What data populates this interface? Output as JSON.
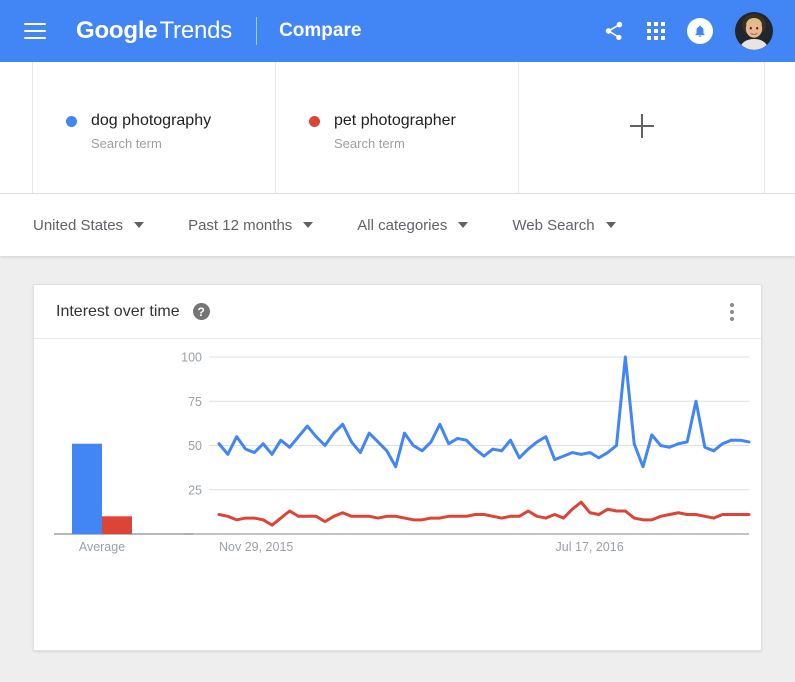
{
  "appbar": {
    "menu_icon": "hamburger-menu-icon",
    "brand_bold": "Google",
    "brand_light": "Trends",
    "page_mode": "Compare",
    "share_icon": "share-icon",
    "apps_icon": "apps-grid-icon",
    "notifications_icon": "bell-icon",
    "avatar_icon": "user-avatar",
    "bg_color": "#4285f4"
  },
  "terms": [
    {
      "name": "dog photography",
      "type": "Search term",
      "color": "#4285f4"
    },
    {
      "name": "pet photographer",
      "type": "Search term",
      "color": "#db4437"
    }
  ],
  "add_term": {
    "icon": "plus-icon",
    "label": "+"
  },
  "filters": [
    {
      "label": "United States",
      "name": "location"
    },
    {
      "label": "Past 12 months",
      "name": "time-range"
    },
    {
      "label": "All categories",
      "name": "category"
    },
    {
      "label": "Web Search",
      "name": "search-type"
    }
  ],
  "card": {
    "title": "Interest over time",
    "help_label": "?",
    "menu_icon": "overflow-menu-icon"
  },
  "chart_data": {
    "type": "line",
    "title": "Interest over time",
    "xlabel": "",
    "ylabel": "",
    "ylim": [
      0,
      100
    ],
    "yticks": [
      25,
      50,
      75,
      100
    ],
    "ytick_labels": [
      "25",
      "50",
      "75",
      "100"
    ],
    "grid": true,
    "legend_position": "above-chart",
    "x_tick_labels": [
      "Nov 29, 2015",
      "Jul 17, 2016"
    ],
    "x_tick_positions": [
      0,
      0.635
    ],
    "average_panel": {
      "label": "Average",
      "values": [
        51,
        10
      ]
    },
    "series": [
      {
        "name": "dog photography",
        "color": "#4285f4",
        "values": [
          51,
          45,
          55,
          48,
          46,
          51,
          45,
          53,
          49,
          55,
          61,
          55,
          50,
          57,
          62,
          52,
          46,
          57,
          52,
          47,
          38,
          57,
          50,
          47,
          52,
          62,
          51,
          54,
          53,
          48,
          44,
          48,
          47,
          53,
          43,
          48,
          52,
          55,
          42,
          44,
          46,
          45,
          46,
          43,
          46,
          50,
          100,
          51,
          38,
          56,
          50,
          49,
          51,
          52,
          75,
          49,
          47,
          51,
          53,
          53,
          52
        ]
      },
      {
        "name": "pet photographer",
        "color": "#db4437",
        "values": [
          11,
          10,
          8,
          9,
          9,
          8,
          5,
          9,
          13,
          10,
          10,
          10,
          7,
          10,
          12,
          10,
          10,
          10,
          9,
          10,
          10,
          9,
          8,
          8,
          9,
          9,
          10,
          10,
          10,
          11,
          11,
          10,
          9,
          10,
          10,
          13,
          10,
          9,
          11,
          9,
          14,
          18,
          12,
          11,
          14,
          13,
          13,
          9,
          8,
          8,
          10,
          11,
          12,
          11,
          11,
          10,
          9,
          11,
          11,
          11,
          11
        ]
      }
    ]
  }
}
